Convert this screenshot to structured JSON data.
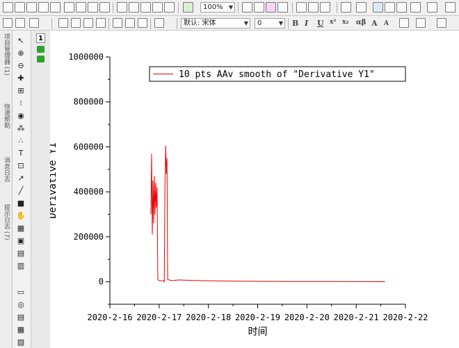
{
  "toolbar": {
    "zoom_value": "100%",
    "font_value": "默认: 宋体",
    "font_size_value": "0",
    "bold_label": "B",
    "italic_label": "I",
    "underline_label": "U",
    "superscript_label": "x²",
    "subscript_label": "x₂",
    "greek_label": "αβ",
    "bigger_label": "A",
    "smaller_label": "A"
  },
  "side_tabs": [
    "项目管理器 (1)",
    "快速帮助",
    "消息日志",
    "提示日志 (7)"
  ],
  "window": {
    "layer_number": "1"
  },
  "colors": {
    "series_line": "#e60000",
    "toolbar_bg": "#f0f0f0",
    "lock_green": "#2ea12e"
  },
  "chart_data": {
    "type": "line",
    "xlabel": "时间",
    "ylabel": "Derivative Y1",
    "x_ticks": [
      "2020-2-16",
      "2020-2-17",
      "2020-2-18",
      "2020-2-19",
      "2020-2-20",
      "2020-2-21",
      "2020-2-22"
    ],
    "y_ticks": [
      "0",
      "200000",
      "400000",
      "600000",
      "800000",
      "1000000"
    ],
    "xlim": [
      "2020-02-16T00:00",
      "2020-02-22T00:00"
    ],
    "ylim": [
      -100000,
      1000000
    ],
    "legend_position": "top-right",
    "series": [
      {
        "name": "10 pts AAv smooth of \"Derivative Y1\"",
        "color": "#e60000",
        "points": [
          [
            "2020-02-16T20:00",
            300000
          ],
          [
            "2020-02-16T20:20",
            570000
          ],
          [
            "2020-02-16T20:40",
            210000
          ],
          [
            "2020-02-16T21:00",
            450000
          ],
          [
            "2020-02-16T21:20",
            260000
          ],
          [
            "2020-02-16T21:40",
            470000
          ],
          [
            "2020-02-16T22:00",
            300000
          ],
          [
            "2020-02-16T22:20",
            440000
          ],
          [
            "2020-02-16T22:40",
            330000
          ],
          [
            "2020-02-16T23:00",
            420000
          ],
          [
            "2020-02-16T23:20",
            10000
          ],
          [
            "2020-02-17T00:00",
            5000
          ],
          [
            "2020-02-17T02:00",
            5000
          ],
          [
            "2020-02-17T02:30",
            0
          ],
          [
            "2020-02-17T02:50",
            420000
          ],
          [
            "2020-02-17T03:10",
            605000
          ],
          [
            "2020-02-17T03:30",
            480000
          ],
          [
            "2020-02-17T03:50",
            550000
          ],
          [
            "2020-02-17T04:10",
            10000
          ],
          [
            "2020-02-17T06:00",
            5000
          ],
          [
            "2020-02-17T10:00",
            8000
          ],
          [
            "2020-02-17T16:00",
            6000
          ],
          [
            "2020-02-18T00:00",
            4000
          ],
          [
            "2020-02-18T12:00",
            3000
          ],
          [
            "2020-02-19T00:00",
            2000
          ],
          [
            "2020-02-19T12:00",
            1500
          ],
          [
            "2020-02-20T00:00",
            1000
          ],
          [
            "2020-02-20T12:00",
            1000
          ],
          [
            "2020-02-21T00:00",
            800
          ],
          [
            "2020-02-21T12:00",
            500
          ],
          [
            "2020-02-21T14:00",
            500
          ]
        ]
      }
    ]
  }
}
